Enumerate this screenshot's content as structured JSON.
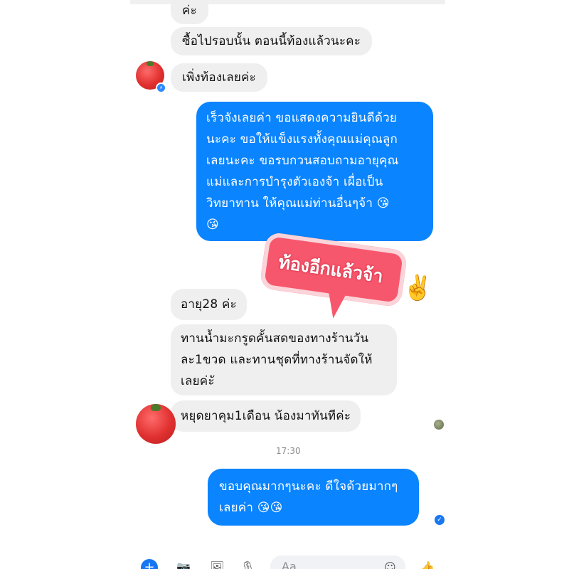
{
  "messages": {
    "m0": "ค่ะ",
    "m1": "ซื้อไปรอบนั้น ตอนนี้ท้องแล้วนะคะ",
    "m2": "เพิ่งท้องเลยค่ะ",
    "m3": [
      "เร็วจังเลยค่า ขอแสดงความยินดีด้วย",
      "นะคะ ขอให้แข็งแรงทั้งคุณแม่คุณลูก",
      "เลยนะคะ ขอรบกวนสอบถามอายุคุณ",
      "แม่และการบำรุงตัวเองจ้า เผื่อเป็น",
      "วิทยาทาน ให้คุณแม่ท่านอื่นๆจ้า 😘",
      "😘"
    ],
    "m4": "อายุ28 ค่ะ",
    "m5": [
      "ทานน้ำมะกรูดคั้นสดของทางร้านวัน",
      "ละ1ขวด และทานชุดที่ทางร้านจัดให้",
      "เลยค่ะั"
    ],
    "m6": "หยุดยาคุม1เดือน น้องมาทันทีค่ะ",
    "m7": [
      "ขอบคุณมากๆนะคะ ดีใจด้วยมากๆ",
      "เลยค่า 😘😘"
    ]
  },
  "sticker": {
    "text": "ท้องอีกแล้วจ้า",
    "emoji": "✌️"
  },
  "timestamp": "17:30",
  "composer": {
    "placeholder": "Aa",
    "plus": "+",
    "camera_icon": "📷",
    "photo_icon": "🖼",
    "mic_icon": "🎙",
    "emoji_icon": "☺",
    "like_icon": "👍"
  },
  "colors": {
    "outgoing": "#0a84ff",
    "incoming": "#efefef"
  }
}
